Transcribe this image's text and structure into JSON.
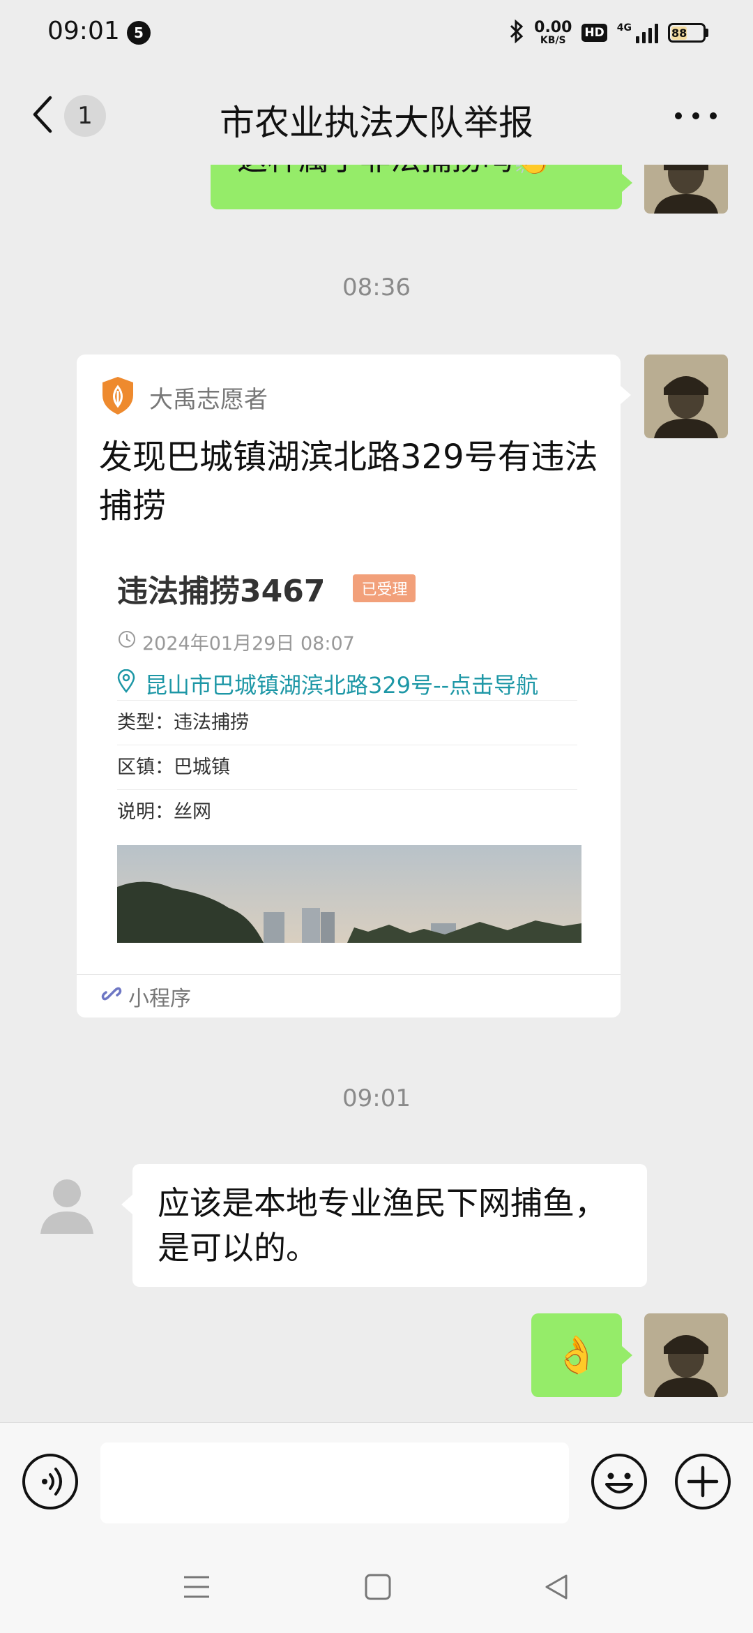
{
  "status_bar": {
    "time": "09:01",
    "notification_count": "5",
    "net_speed_value": "0.00",
    "net_speed_unit": "KB/S",
    "hd_label": "HD",
    "network_type": "4G",
    "battery": "88"
  },
  "header": {
    "unread_count": "1",
    "title": "市农业执法大队举报"
  },
  "messages": {
    "top_partial_text": "这种属于非法捕捞吗👏",
    "time_1": "08:36",
    "card": {
      "source_name": "大禹志愿者",
      "title": "发现巴城镇湖滨北路329号有违法捕捞",
      "item_title": "违法捕捞3467",
      "status": "已受理",
      "datetime": "2024年01月29日 08:07",
      "address": "昆山市巴城镇湖滨北路329号--点击导航",
      "rows": [
        {
          "text": "类型：违法捕捞"
        },
        {
          "text": "区镇：巴城镇"
        },
        {
          "text": "说明：丝网"
        }
      ],
      "footer_label": "小程序"
    },
    "time_2": "09:01",
    "reply_text": "应该是本地专业渔民下网捕鱼，是可以的。",
    "emoji_reply": "👌"
  },
  "input": {
    "placeholder": ""
  },
  "colors": {
    "background": "#ededed",
    "bubble_sent": "#95ec69",
    "bubble_received": "#ffffff",
    "status_tag": "#f2a07a",
    "link": "#1d97a6"
  }
}
